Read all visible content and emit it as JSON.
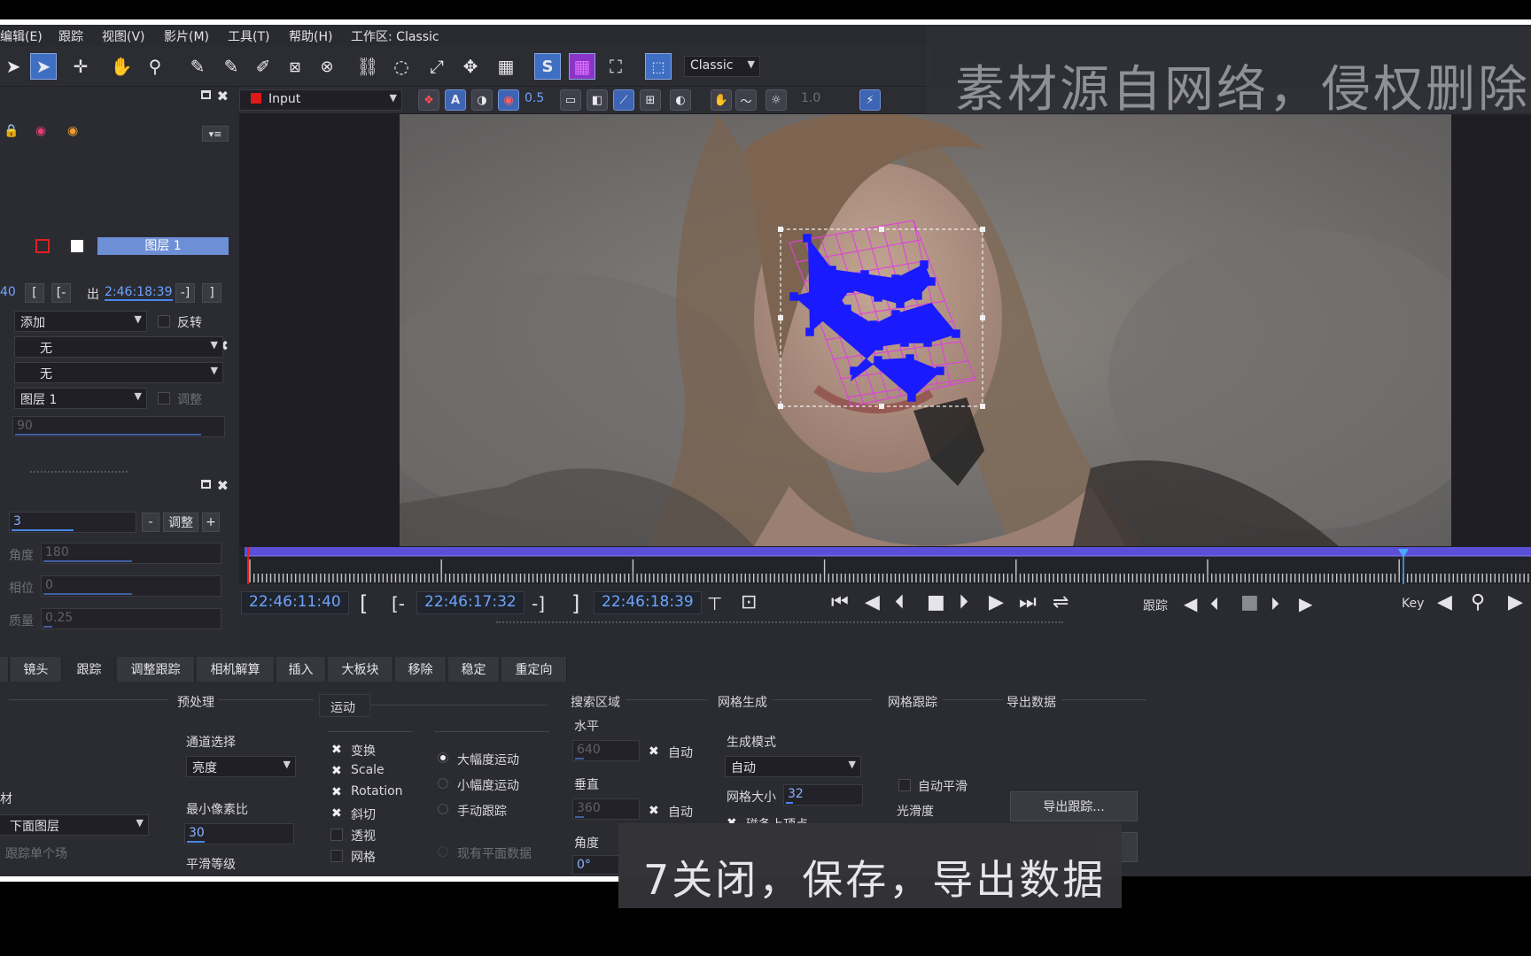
{
  "menu": [
    "编辑(E)",
    "跟踪",
    "视图(V)",
    "影片(M)",
    "工具(T)",
    "帮助(H)",
    "工作区: Classic"
  ],
  "toolbar": {
    "s_button": "S",
    "workspace_dropdown": "Classic"
  },
  "viewer_toolbar": {
    "input_dropdown": "Input",
    "value_1": "0.5",
    "value_2": "1.0"
  },
  "watermark": "素材源自网络，侵权删除",
  "layers": {
    "layer_name": "图层 1"
  },
  "clip_panel": {
    "in_value": "40",
    "out_label": "出",
    "out_value": "2:46:18:39",
    "blend_mode": "添加",
    "invert_label": "反转",
    "matte_1": "无",
    "matte_2": "无",
    "track_layer": "图层 1",
    "adjust_label": "调整",
    "value_90": "90"
  },
  "params_panel": {
    "value_3": "3",
    "adjust_button": "调整",
    "minus": "-",
    "plus": "+",
    "angle_label": "角度",
    "angle_value": "180",
    "phase_label": "相位",
    "phase_value": "0",
    "quality_label": "质量",
    "quality_value": "0.25"
  },
  "transport": {
    "current_time": "22:46:11:40",
    "in_time": "22:46:17:32",
    "out_time": "22:46:18:39",
    "bracket_open": "[",
    "in_mark": "[-",
    "out_mark": "-]",
    "bracket_close": "]",
    "track_label": "跟踪",
    "key_label": "Key"
  },
  "tabs": [
    "镜头",
    "跟踪",
    "调整跟踪",
    "相机解算",
    "插入",
    "大板块",
    "移除",
    "稳定",
    "重定向"
  ],
  "bottom": {
    "preprocess": {
      "header": "预处理",
      "channel_label": "通道选择",
      "channel_value": "亮度",
      "min_pixel_label": "最小像素比",
      "min_pixel_value": "30",
      "smooth_label": "平滑等级",
      "left_label": "材",
      "below_layer": "下面图层",
      "track_single_field": "跟踪单个场"
    },
    "motion": {
      "tab": "运动",
      "checks": [
        "变换",
        "Scale",
        "Rotation",
        "斜切",
        "透视",
        "网格"
      ],
      "radios": [
        "大幅度运动",
        "小幅度运动",
        "手动跟踪",
        "现有平面数据"
      ]
    },
    "search": {
      "header": "搜索区域",
      "horizontal_label": "水平",
      "horizontal_value": "640",
      "auto_1": "自动",
      "vertical_label": "垂直",
      "vertical_value": "360",
      "auto_2": "自动",
      "angle_label": "角度",
      "angle_value": "0°"
    },
    "mesh_gen": {
      "header": "网格生成",
      "mode_label": "生成模式",
      "mode_value": "自动",
      "size_label": "网格大小",
      "size_value": "32",
      "snap_label": "磁条上顶点"
    },
    "mesh_track": {
      "header": "网格跟踪",
      "auto_smooth": "自动平滑",
      "smoothness": "光滑度"
    },
    "export": {
      "header": "导出数据",
      "export_button": "导出跟踪..."
    }
  },
  "subtitle": "7关闭，保存，导出数据",
  "colors": {
    "accent": "#4a86e8",
    "mesh": "#e040e0",
    "tracker": "#1a1aff",
    "timeline": "#5a4fd6",
    "selection": "#3f6fc2"
  }
}
